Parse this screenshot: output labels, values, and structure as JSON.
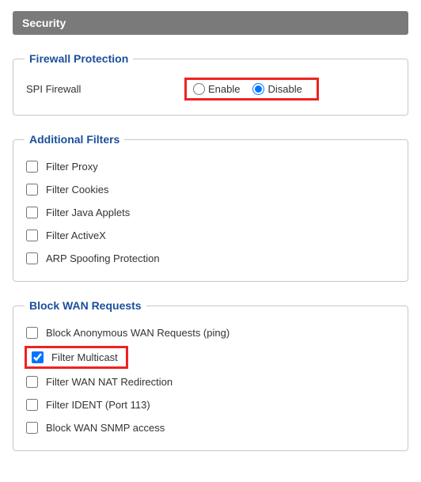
{
  "title": "Security",
  "firewallProtection": {
    "legend": "Firewall Protection",
    "row": {
      "label": "SPI Firewall",
      "enable": "Enable",
      "disable": "Disable",
      "selected": "disable"
    }
  },
  "additionalFilters": {
    "legend": "Additional Filters",
    "items": [
      {
        "label": "Filter Proxy",
        "checked": false
      },
      {
        "label": "Filter Cookies",
        "checked": false
      },
      {
        "label": "Filter Java Applets",
        "checked": false
      },
      {
        "label": "Filter ActiveX",
        "checked": false
      },
      {
        "label": "ARP Spoofing Protection",
        "checked": false
      }
    ]
  },
  "blockWan": {
    "legend": "Block WAN Requests",
    "items": [
      {
        "label": "Block Anonymous WAN Requests (ping)",
        "checked": false,
        "highlight": false
      },
      {
        "label": "Filter Multicast",
        "checked": true,
        "highlight": true
      },
      {
        "label": "Filter WAN NAT Redirection",
        "checked": false,
        "highlight": false
      },
      {
        "label": "Filter IDENT (Port 113)",
        "checked": false,
        "highlight": false
      },
      {
        "label": "Block WAN SNMP access",
        "checked": false,
        "highlight": false
      }
    ]
  }
}
